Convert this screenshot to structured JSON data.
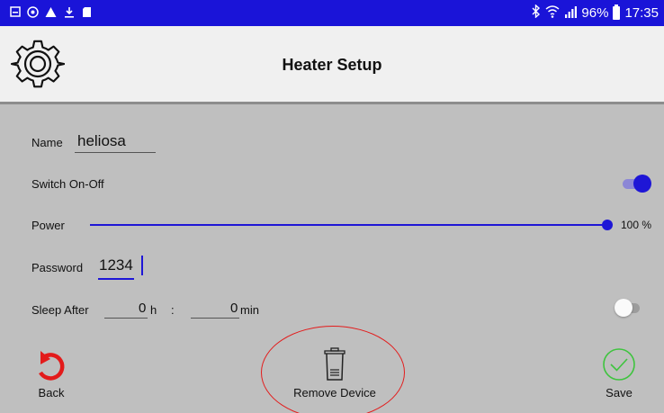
{
  "status_bar": {
    "left_icons": [
      "notification-icon",
      "sync-icon",
      "warning-icon",
      "download-icon",
      "sd-card-icon"
    ],
    "right_icons": [
      "bluetooth-icon",
      "wifi-icon",
      "signal-icon"
    ],
    "battery": "96%",
    "time": "17:35",
    "background_color": "#1a14d8"
  },
  "appbar": {
    "icon": "gear-icon",
    "title": "Heater Setup"
  },
  "form": {
    "name_label": "Name",
    "name_value": "heliosa",
    "switch_label": "Switch On-Off",
    "switch_on": true,
    "power_label": "Power",
    "power_value": "100 %",
    "power_fraction": 1.0,
    "password_label": "Password",
    "password_value": "1234",
    "sleep_label": "Sleep After",
    "sleep_hours": "0",
    "sleep_hours_unit": "h",
    "sleep_sep": ":",
    "sleep_minutes": "0",
    "sleep_minutes_unit": "min",
    "sleep_on": false
  },
  "actions": {
    "back_label": "Back",
    "remove_label": "Remove Device",
    "save_label": "Save"
  },
  "colors": {
    "accent": "#1e16d6",
    "back_icon": "#e31b1b",
    "save_icon": "#3ec43e",
    "highlight": "#e31b1b"
  }
}
